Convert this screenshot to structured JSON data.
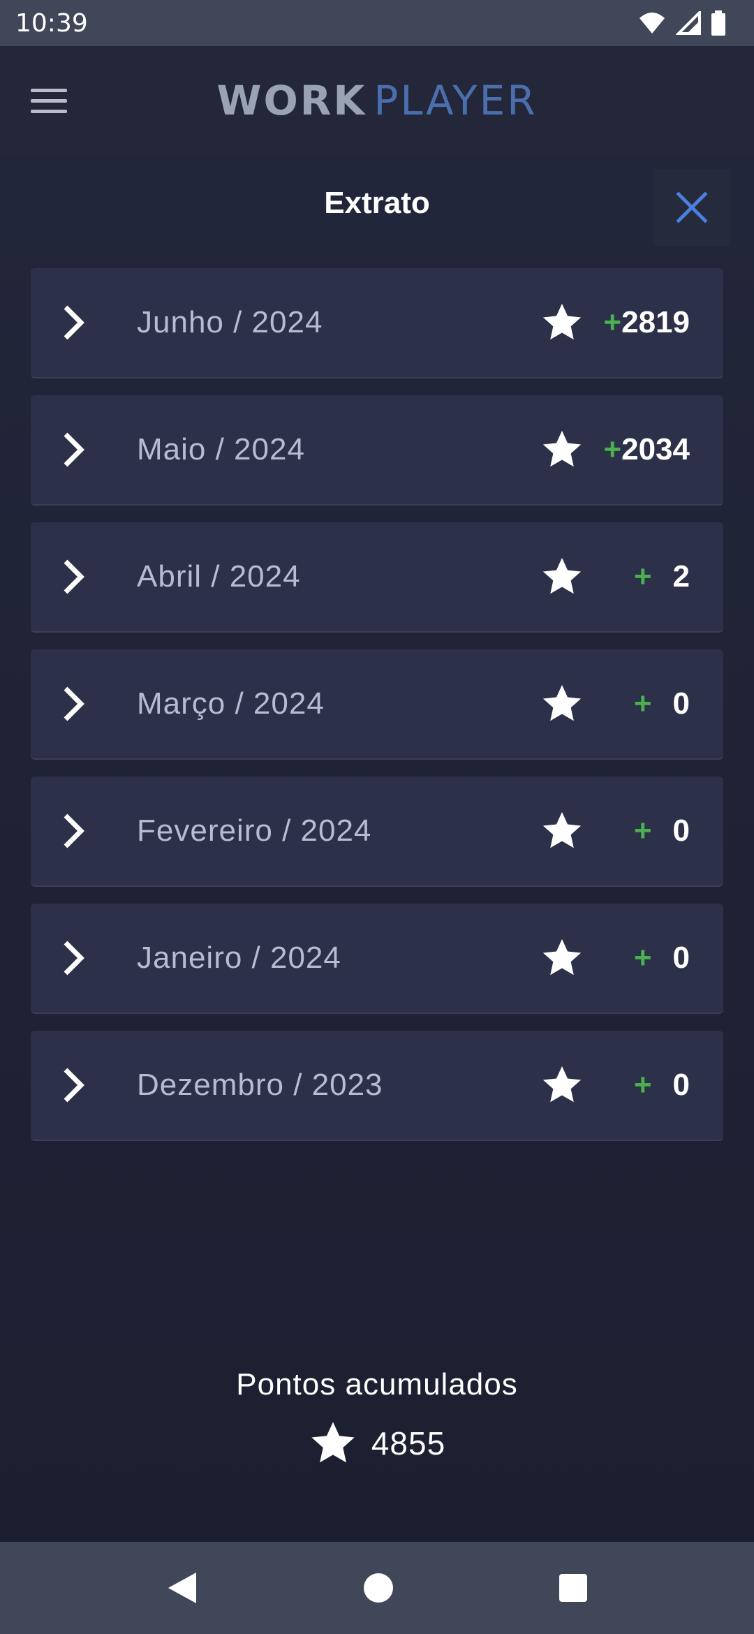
{
  "status_bar": {
    "time": "10:39"
  },
  "app_bar": {
    "logo_word1": "WORK",
    "logo_word2": "PLAYER"
  },
  "page": {
    "title": "Extrato"
  },
  "months": [
    {
      "label": "Junho / 2024",
      "plus": "+",
      "points": "2819"
    },
    {
      "label": "Maio / 2024",
      "plus": "+",
      "points": "2034"
    },
    {
      "label": "Abril / 2024",
      "plus": "+",
      "points": "2"
    },
    {
      "label": "Março / 2024",
      "plus": "+",
      "points": "0"
    },
    {
      "label": "Fevereiro / 2024",
      "plus": "+",
      "points": "0"
    },
    {
      "label": "Janeiro / 2024",
      "plus": "+",
      "points": "0"
    },
    {
      "label": "Dezembro / 2023",
      "plus": "+",
      "points": "0"
    }
  ],
  "summary": {
    "label": "Pontos acumulados",
    "total": "4855"
  },
  "colors": {
    "accent_blue": "#4b7fe0",
    "positive_green": "#4caf50",
    "row_bg": "#2c3049"
  }
}
